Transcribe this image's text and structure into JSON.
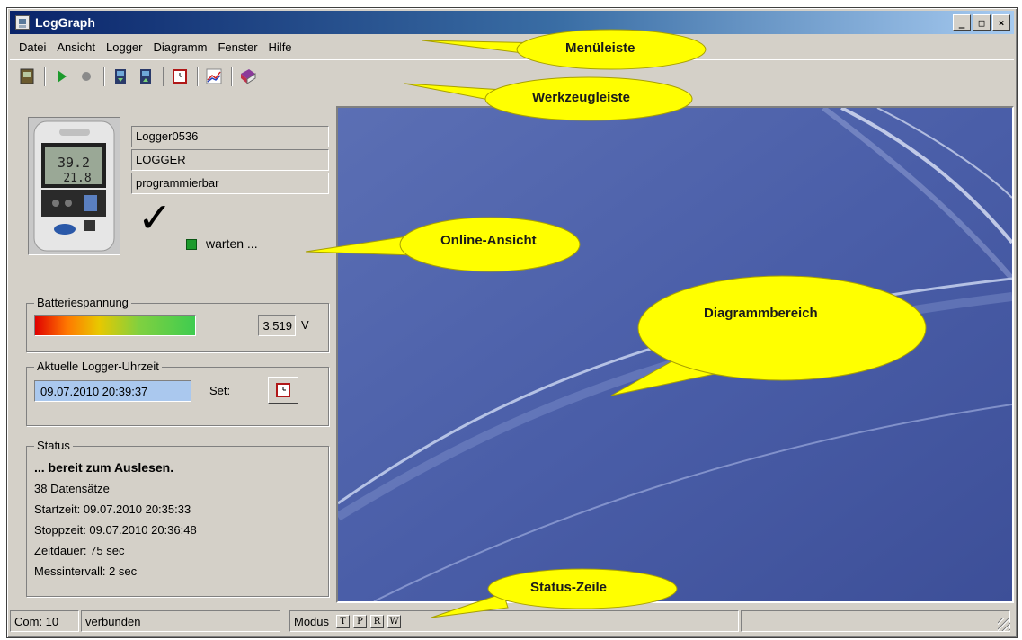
{
  "window": {
    "title": "LogGraph",
    "min_label": "_",
    "max_label": "□",
    "close_label": "×"
  },
  "menu": {
    "items": [
      "Datei",
      "Ansicht",
      "Logger",
      "Diagramm",
      "Fenster",
      "Hilfe"
    ]
  },
  "toolbar": {
    "icons": [
      "logger-read-icon",
      "play-icon",
      "record-icon",
      "download-icon",
      "upload-icon",
      "clock-set-icon",
      "chart-icon",
      "book-icon"
    ]
  },
  "device": {
    "name": "Logger0536",
    "type": "LOGGER",
    "mode": "programmierbar",
    "online_status": "warten ...",
    "display_top": "39.2",
    "display_bottom": "21.8"
  },
  "battery": {
    "title": "Batteriespannung",
    "voltage": "3,519",
    "unit": "V"
  },
  "clock": {
    "title": "Aktuelle Logger-Uhrzeit",
    "value": "09.07.2010 20:39:37",
    "set_label": "Set:"
  },
  "status": {
    "title": "Status",
    "headline": "... bereit zum Auslesen.",
    "records": "38 Datensätze",
    "start": "Startzeit: 09.07.2010 20:35:33",
    "stop": "Stoppzeit: 09.07.2010 20:36:48",
    "duration": "Zeitdauer: 75 sec",
    "interval": "Messintervall: 2 sec"
  },
  "statusbar": {
    "com": "Com: 10",
    "connection": "verbunden",
    "mode_label": "Modus",
    "mode_flags": [
      "T",
      "P",
      "R",
      "W"
    ]
  },
  "callouts": {
    "menubar": "Menüleiste",
    "toolbar": "Werkzeugleiste",
    "online": "Online-Ansicht",
    "chart_area": "Diagrammbereich",
    "statusline": "Status-Zeile"
  },
  "colors": {
    "callout_fill": "#ffff00",
    "chart_bg": "#4a5ea8",
    "titlebar": "#0a246a"
  }
}
